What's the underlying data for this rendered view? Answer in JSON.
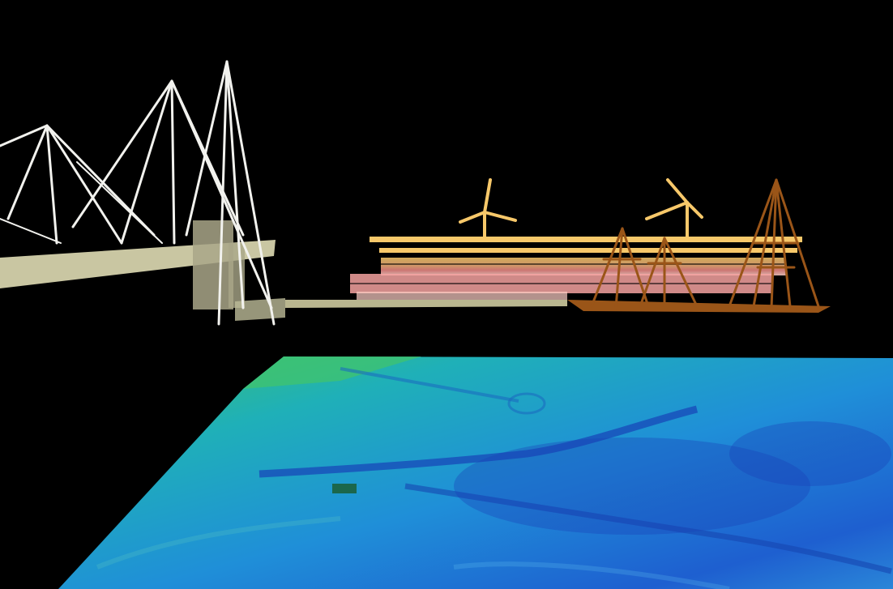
{
  "scene": {
    "kind": "3d-point-cloud-render",
    "background_color": "#000000",
    "objects": [
      {
        "name": "cable-stayed-bridge",
        "color": "#f2f2ee"
      },
      {
        "name": "bridge-deck",
        "color": "#c9c6a2"
      },
      {
        "name": "quay-wall",
        "color": "#b9b68f"
      },
      {
        "name": "waterfront-building",
        "colors": [
          "#f7c86a",
          "#f08a86",
          "#ffd0c8"
        ]
      },
      {
        "name": "sailing-ship",
        "color": "#9a5518"
      },
      {
        "name": "seabed-bathymetry",
        "colors": [
          "#3cc36a",
          "#1fa6c8",
          "#1e5fd0",
          "#123aa8"
        ]
      }
    ]
  }
}
